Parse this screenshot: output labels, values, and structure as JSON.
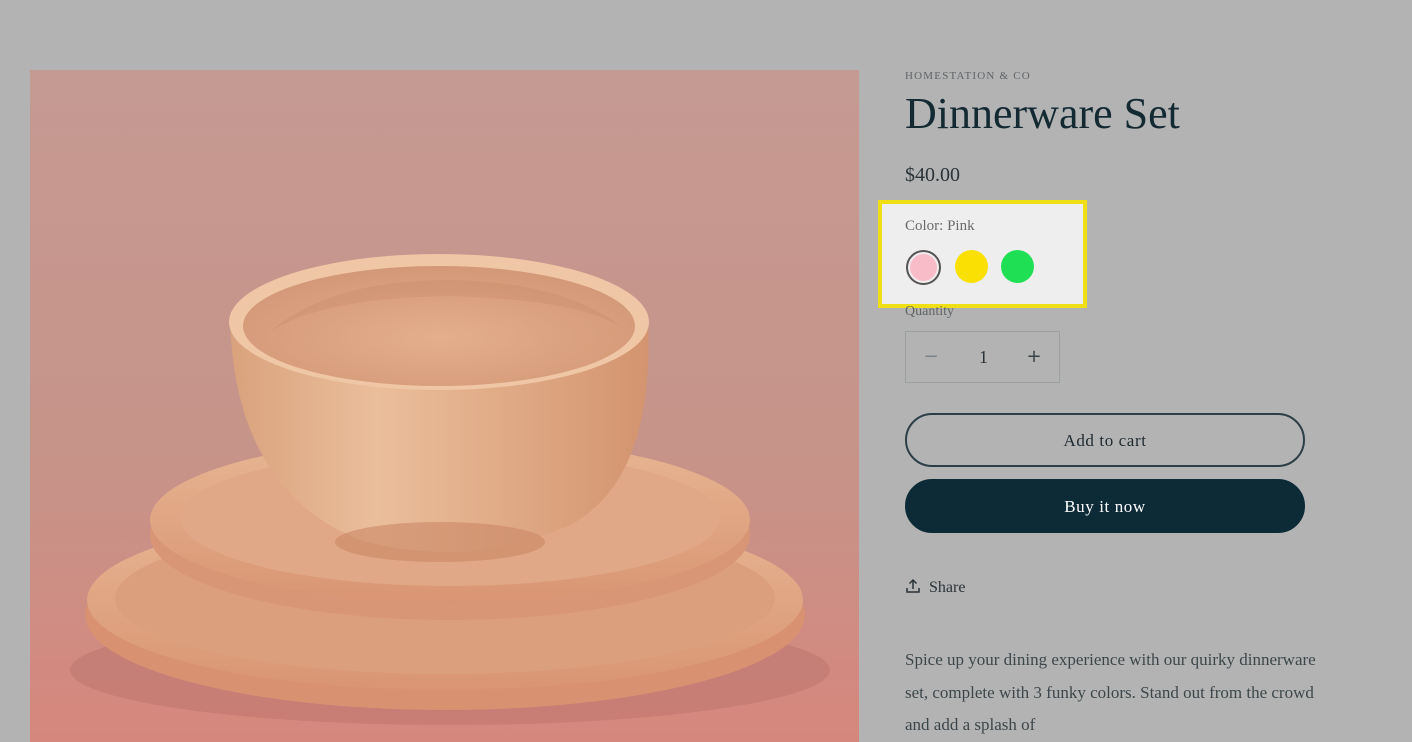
{
  "product": {
    "vendor": "HOMESTATION & CO",
    "title": "Dinnerware Set",
    "price": "$40.00",
    "image_alt": "Pink dinnerware set with bowl and plates",
    "color": {
      "label": "Color: Pink",
      "options": [
        {
          "name": "Pink",
          "hex": "#f8bcc8",
          "selected": true
        },
        {
          "name": "Yellow",
          "hex": "#fae003",
          "selected": false
        },
        {
          "name": "Green",
          "hex": "#1fe055",
          "selected": false
        }
      ],
      "highlight_color": "#f1df15"
    },
    "quantity": {
      "label": "Quantity",
      "value": "1",
      "minus": "−",
      "plus": "+"
    },
    "buttons": {
      "add_to_cart": "Add to cart",
      "buy_now": "Buy it now"
    },
    "share_label": "Share",
    "description": "Spice up your dining experience with our quirky dinnerware set, complete with 3 funky colors. Stand out from the crowd and add a splash of"
  },
  "colors": {
    "page_background": "#b3b3b3",
    "buy_button": "#0d2b36"
  }
}
